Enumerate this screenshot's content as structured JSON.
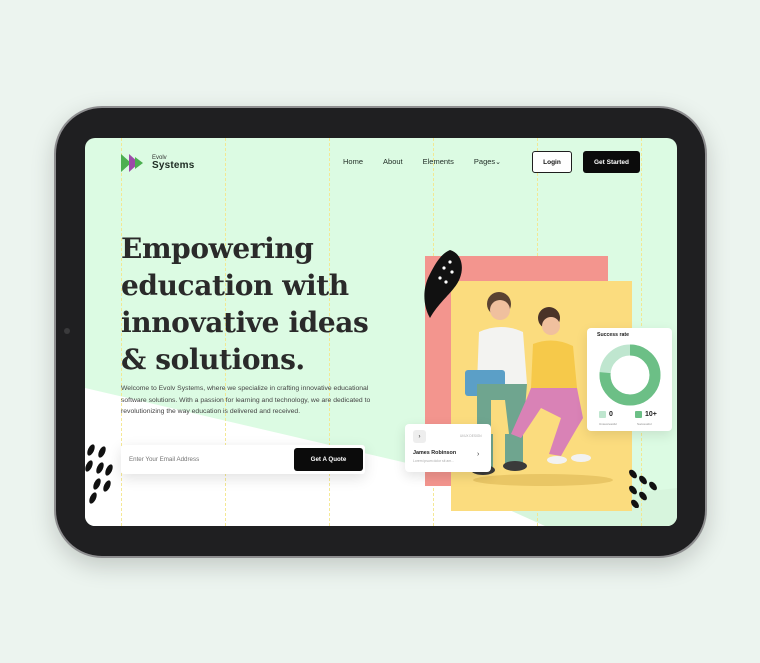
{
  "brand": {
    "small": "Evolv",
    "name": "Systems"
  },
  "nav": {
    "items": [
      "Home",
      "About",
      "Elements",
      "Pages"
    ],
    "pages_caret": "⌄"
  },
  "header": {
    "login_label": "Login",
    "start_label": "Get Started"
  },
  "hero": {
    "title": "Empowering education with innovative ideas & solutions.",
    "description": "Welcome to Evolv Systems, where we specialize in crafting innovative educational software solutions. With a passion for learning and technology, we are dedicated to revolutionizing the way education is delivered and received.",
    "email_placeholder": "Enter Your Email Address",
    "quote_label": "Get A Quote"
  },
  "user_card": {
    "icon": "›",
    "tag": "UI/UX DESIGN",
    "name": "James Robinson",
    "subtitle": "Lorem ipsum dolor sit am...",
    "arrow": "›"
  },
  "success_card": {
    "title": "Success rate",
    "stats": [
      {
        "value": "0",
        "label": "Unsuccessful",
        "color": "#bfe6cf"
      },
      {
        "value": "10+",
        "label": "Successful",
        "color": "#6cbf86"
      }
    ]
  },
  "colors": {
    "accent_green": "#6cbf86",
    "pink": "#f3958e",
    "yellow": "#fbdc7e",
    "bg_mint": "#dcfbe3",
    "logo_green": "#4caf50",
    "logo_purple": "#9c4aa8"
  },
  "icons": [
    "logo-mark-icon",
    "leaf-icon",
    "chevron-right-icon",
    "chevron-down-icon"
  ]
}
